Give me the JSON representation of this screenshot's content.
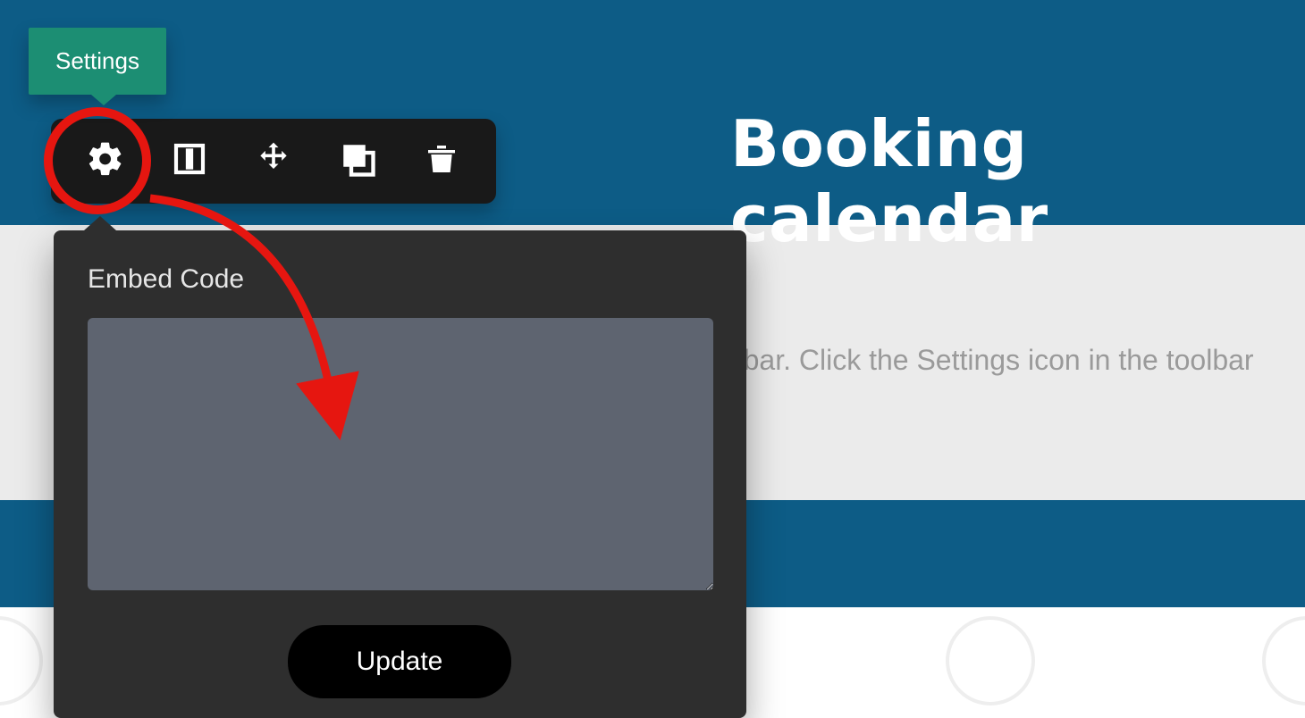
{
  "tooltip": {
    "label": "Settings"
  },
  "heading": {
    "text": "Booking calendar"
  },
  "instruction": {
    "text": "toolbar. Click the Settings icon in the toolbar"
  },
  "toolbar": {
    "settings_name": "settings-icon",
    "column_name": "column-icon",
    "move_name": "move-icon",
    "duplicate_name": "duplicate-icon",
    "delete_name": "delete-icon"
  },
  "panel": {
    "label": "Embed Code",
    "textarea_value": "",
    "textarea_placeholder": "",
    "update_label": "Update"
  },
  "annotation": {
    "circle_color": "#e61610",
    "arrow_color": "#e61610"
  }
}
